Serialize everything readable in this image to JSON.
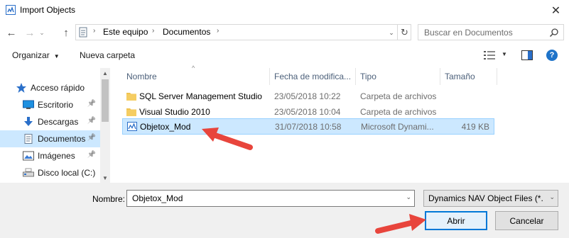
{
  "window": {
    "title": "Import Objects",
    "close_glyph": "✕"
  },
  "nav": {
    "back_glyph": "←",
    "forward_glyph": "→",
    "recent_glyph": "⌄",
    "up_glyph": "↑",
    "breadcrumbs": [
      "Este equipo",
      "Documentos"
    ],
    "breadcrumb_sep": "›",
    "refresh_glyph": "↻",
    "dropdown_glyph": "⌄"
  },
  "search": {
    "placeholder": "Buscar en Documentos"
  },
  "toolbar": {
    "organize_label": "Organizar",
    "organize_caret": "▼",
    "new_folder_label": "Nueva carpeta",
    "view_caret": "▼",
    "help_label": "?"
  },
  "sidebar": {
    "items": [
      {
        "label": "Acceso rápido",
        "icon": "star-icon",
        "pinned": false
      },
      {
        "label": "Escritorio",
        "icon": "desktop-icon",
        "pinned": true
      },
      {
        "label": "Descargas",
        "icon": "download-icon",
        "pinned": true
      },
      {
        "label": "Documentos",
        "icon": "documents-icon",
        "pinned": true,
        "selected": true
      },
      {
        "label": "Imágenes",
        "icon": "pictures-icon",
        "pinned": true
      },
      {
        "label": "Disco local (C:)",
        "icon": "drive-icon",
        "pinned": false
      }
    ],
    "pin_glyph": "📌",
    "scroll_up_glyph": "▲",
    "scroll_down_glyph": "▼"
  },
  "columns": {
    "name": "Nombre",
    "date": "Fecha de modifica...",
    "type": "Tipo",
    "size": "Tamaño",
    "sort_glyph": "^"
  },
  "files": [
    {
      "name": "SQL Server Management Studio",
      "date": "23/05/2018 10:22",
      "type": "Carpeta de archivos",
      "size": "",
      "kind": "folder"
    },
    {
      "name": "Visual Studio 2010",
      "date": "23/05/2018 10:04",
      "type": "Carpeta de archivos",
      "size": "",
      "kind": "folder"
    },
    {
      "name": "Objetox_Mod",
      "date": "31/07/2018 10:58",
      "type": "Microsoft Dynami...",
      "size": "419 KB",
      "kind": "nav-object",
      "selected": true
    }
  ],
  "footer": {
    "name_label": "Nombre:",
    "name_value": "Objetox_Mod",
    "filter_value": "Dynamics NAV Object Files (*.fob)",
    "open_label": "Abrir",
    "cancel_label": "Cancelar",
    "dropdown_glyph": "⌄"
  },
  "colors": {
    "accent": "#0078d7",
    "selection": "#cce8ff",
    "folder": "#f0c350",
    "annotation_arrow": "#e8453c"
  }
}
